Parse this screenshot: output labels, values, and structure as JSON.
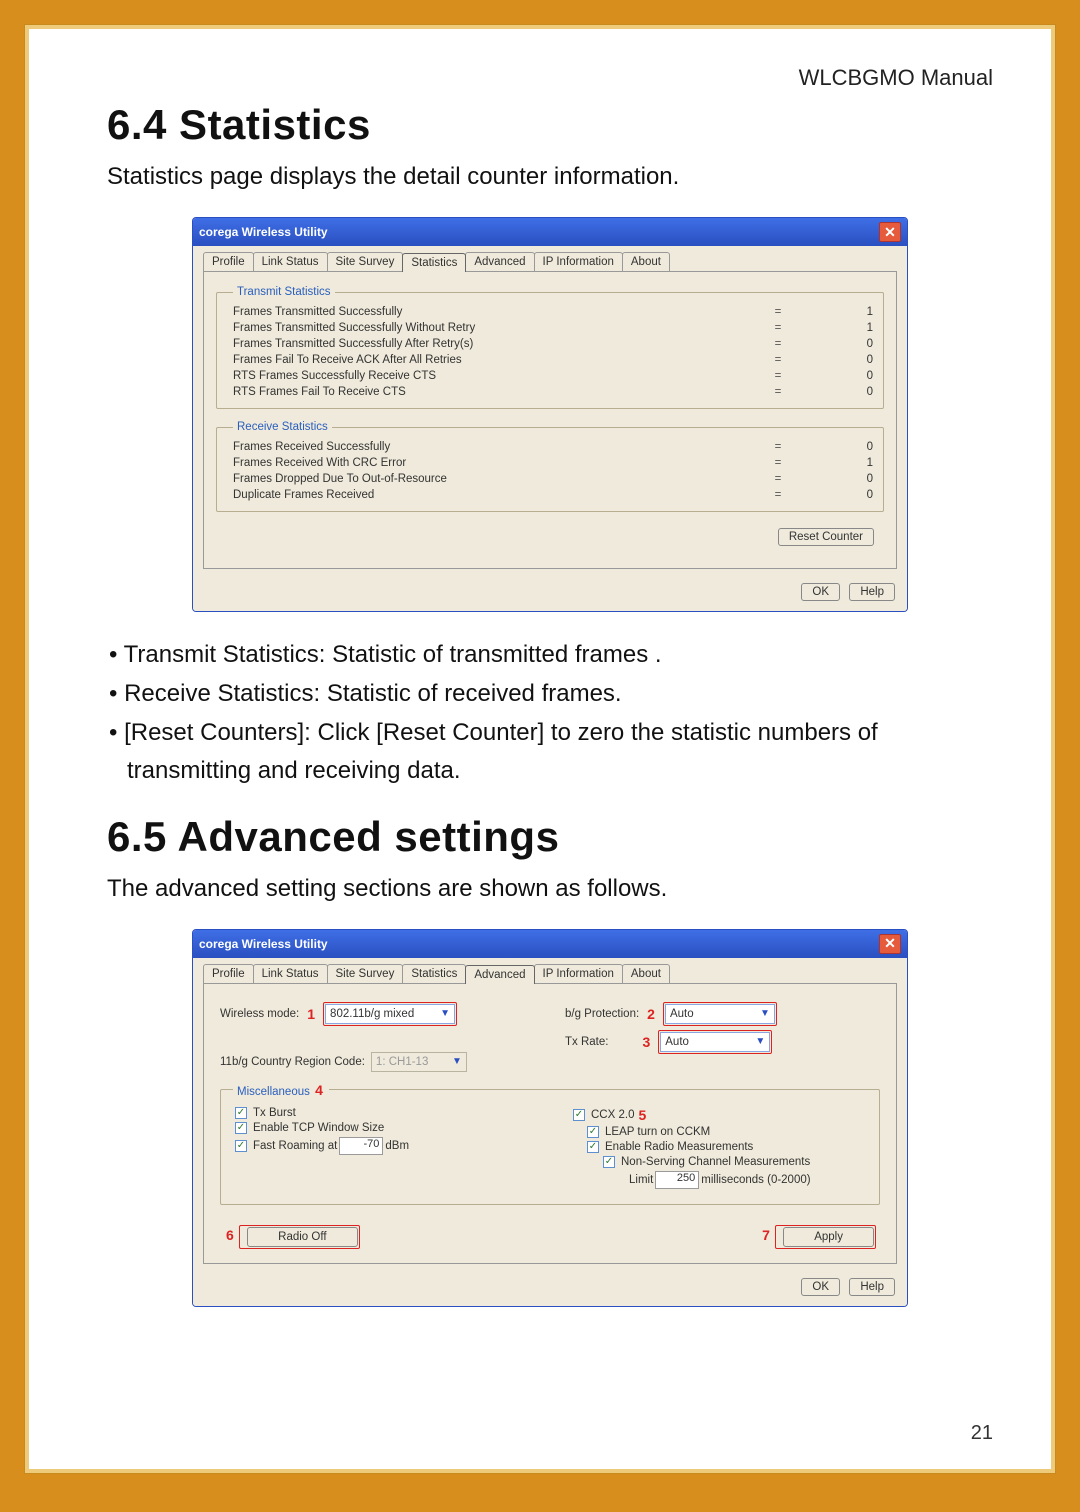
{
  "doc": {
    "running_head": "WLCBGMO  Manual",
    "page_number": "21",
    "sec_64_title": "6.4 Statistics",
    "sec_64_intro": "Statistics page displays the detail counter information.",
    "sec_64_b1": "Transmit Statistics: Statistic of transmitted frames .",
    "sec_64_b2": "Receive Statistics: Statistic of received frames.",
    "sec_64_b3": "[Reset Counters]: Click [Reset Counter] to zero the statistic numbers of transmitting and receiving data.",
    "sec_65_title": "6.5  Advanced settings",
    "sec_65_intro": "The advanced setting sections are shown as follows."
  },
  "win": {
    "title": "corega Wireless Utility",
    "tabs": {
      "profile": "Profile",
      "link": "Link Status",
      "survey": "Site Survey",
      "stats": "Statistics",
      "advanced": "Advanced",
      "ipinfo": "IP Information",
      "about": "About"
    },
    "buttons": {
      "reset": "Reset Counter",
      "ok": "OK",
      "help": "Help",
      "radio_off": "Radio Off",
      "apply": "Apply"
    }
  },
  "stats": {
    "tx_legend": "Transmit Statistics",
    "rx_legend": "Receive Statistics",
    "tx": [
      {
        "lbl": "Frames Transmitted Successfully",
        "val": "1"
      },
      {
        "lbl": "Frames Transmitted Successfully  Without Retry",
        "val": "1"
      },
      {
        "lbl": "Frames Transmitted Successfully After Retry(s)",
        "val": "0"
      },
      {
        "lbl": "Frames Fail To Receive ACK After All Retries",
        "val": "0"
      },
      {
        "lbl": "RTS Frames Successfully Receive CTS",
        "val": "0"
      },
      {
        "lbl": "RTS Frames Fail To Receive CTS",
        "val": "0"
      }
    ],
    "rx": [
      {
        "lbl": "Frames Received Successfully",
        "val": "0"
      },
      {
        "lbl": "Frames Received With CRC Error",
        "val": "1"
      },
      {
        "lbl": "Frames Dropped Due To Out-of-Resource",
        "val": "0"
      },
      {
        "lbl": "Duplicate Frames Received",
        "val": "0"
      }
    ]
  },
  "adv": {
    "markers": {
      "m1": "1",
      "m2": "2",
      "m3": "3",
      "m4": "4",
      "m5": "5",
      "m6": "6",
      "m7": "7"
    },
    "labels": {
      "wireless_mode": "Wireless mode:",
      "country_code": "11b/g Country Region Code:",
      "bg_prot": "b/g Protection:",
      "tx_rate": "Tx Rate:",
      "misc": "Miscellaneous",
      "tx_burst": "Tx Burst",
      "tcp_win": "Enable TCP Window Size",
      "fast_roam": "Fast Roaming at",
      "dbm": "dBm",
      "ccx": "CCX 2.0",
      "leap": "LEAP turn on CCKM",
      "radio_meas": "Enable Radio Measurements",
      "nonserv": "Non-Serving Channel Measurements",
      "limit": "Limit",
      "ms": "milliseconds (0-2000)"
    },
    "values": {
      "wireless_mode": "802.11b/g mixed",
      "country_code": "1: CH1-13",
      "bg_prot": "Auto",
      "tx_rate": "Auto",
      "fast_roam_dbm": "-70",
      "limit_ms": "250"
    }
  }
}
